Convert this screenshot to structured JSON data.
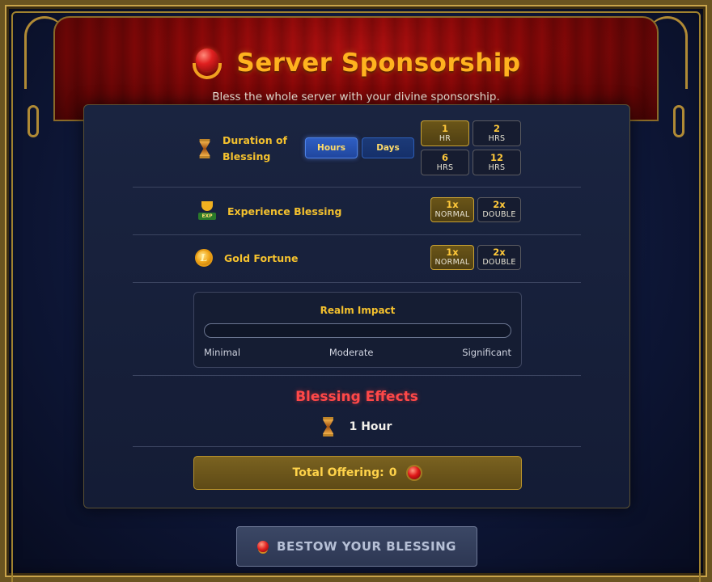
{
  "header": {
    "title": "Server Sponsorship",
    "subtitle": "Bless the whole server with your divine sponsorship.",
    "icon": "sponsor-gem-icon"
  },
  "duration": {
    "label_line1": "Duration of",
    "label_line2": "Blessing",
    "icon": "hourglass-icon",
    "units": [
      {
        "label": "Hours",
        "active": true
      },
      {
        "label": "Days",
        "active": false
      }
    ],
    "options": [
      {
        "value": "1",
        "sub": "HR",
        "active": true
      },
      {
        "value": "2",
        "sub": "HRS",
        "active": false
      },
      {
        "value": "6",
        "sub": "HRS",
        "active": false
      },
      {
        "value": "12",
        "sub": "HRS",
        "active": false
      }
    ]
  },
  "experience": {
    "label": "Experience Blessing",
    "icon": "exp-trophy-icon",
    "icon_text": "EXP",
    "options": [
      {
        "value": "1x",
        "sub": "NORMAL",
        "active": true
      },
      {
        "value": "2x",
        "sub": "DOUBLE",
        "active": false
      }
    ]
  },
  "gold": {
    "label": "Gold Fortune",
    "icon": "gold-coin-icon",
    "icon_text": "L",
    "options": [
      {
        "value": "1x",
        "sub": "NORMAL",
        "active": true
      },
      {
        "value": "2x",
        "sub": "DOUBLE",
        "active": false
      }
    ]
  },
  "impact": {
    "title": "Realm Impact",
    "level": 0,
    "labels": [
      "Minimal",
      "Moderate",
      "Significant"
    ]
  },
  "effects": {
    "title": "Blessing Effects",
    "duration_text": "1 Hour",
    "icon": "hourglass-icon"
  },
  "offering": {
    "label": "Total Offering:",
    "amount": "0",
    "icon": "red-gem-icon"
  },
  "bestow": {
    "label": "BESTOW YOUR BLESSING",
    "icon": "red-gem-icon"
  },
  "colors": {
    "accent_gold": "#f4c12e",
    "title_orange": "#ffb21f",
    "effects_red": "#ff4848",
    "active_blue": "#2f5fc4"
  }
}
